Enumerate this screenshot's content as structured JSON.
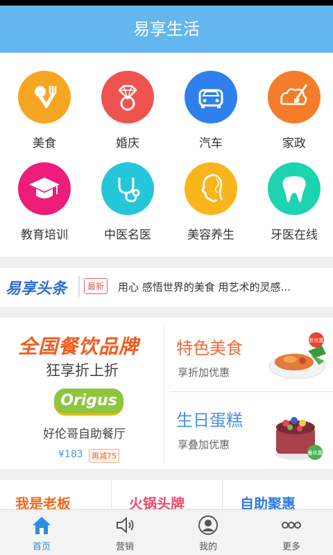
{
  "app": {
    "title": "易享生活"
  },
  "categories": [
    {
      "label": "美食",
      "icon": "fork-knife-icon",
      "color": "#f6a623"
    },
    {
      "label": "婚庆",
      "icon": "diamond-ring-icon",
      "color": "#ef5350"
    },
    {
      "label": "汽车",
      "icon": "car-icon",
      "color": "#2f80ed"
    },
    {
      "label": "家政",
      "icon": "cleaning-icon",
      "color": "#f57c2a"
    },
    {
      "label": "教育培训",
      "icon": "graduation-cap-icon",
      "color": "#ec1e79"
    },
    {
      "label": "中医名医",
      "icon": "stethoscope-icon",
      "color": "#26c6da"
    },
    {
      "label": "美容养生",
      "icon": "beauty-face-icon",
      "color": "#f9b51b"
    },
    {
      "label": "牙医在线",
      "icon": "tooth-icon",
      "color": "#1dd3b0"
    }
  ],
  "news": {
    "brand": "易享头条",
    "badge": "最新",
    "text": "用心 感悟世界的美食 用艺术的灵感..."
  },
  "promo": {
    "left": {
      "title": "全国餐饮品牌",
      "subtitle": "狂享折上折",
      "logo": "Origus",
      "name": "好伦哥自助餐厅",
      "price": "¥183",
      "tag": "再减75"
    },
    "right_top": {
      "title": "特色美食",
      "subtitle": "享折加优惠",
      "badge": "折优惠"
    },
    "right_bottom": {
      "title": "生日蛋糕",
      "subtitle": "享叠加优惠",
      "badge": "叠优惠"
    }
  },
  "bottom_cards": [
    "我是老板",
    "火锅头牌",
    "自助聚惠"
  ],
  "tabs": [
    {
      "label": "首页",
      "icon": "home-icon",
      "active": true
    },
    {
      "label": "营销",
      "icon": "speaker-icon",
      "active": false
    },
    {
      "label": "我的",
      "icon": "user-icon",
      "active": false
    },
    {
      "label": "更多",
      "icon": "more-icon",
      "active": false
    }
  ],
  "colors": {
    "accent": "#63b6ee",
    "brand_orange": "#f35a1c",
    "tab_active": "#2d8de0"
  }
}
